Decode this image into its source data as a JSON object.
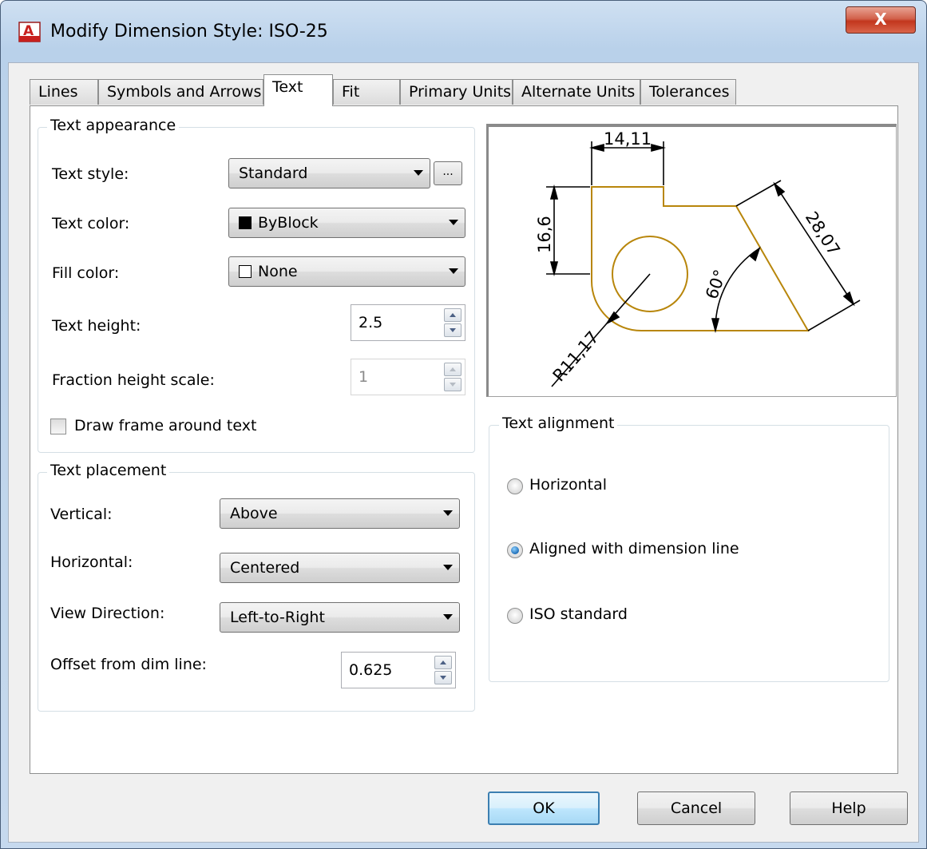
{
  "window": {
    "title": "Modify Dimension Style: ISO-25",
    "close_label": "X"
  },
  "tabs": [
    {
      "label": "Lines"
    },
    {
      "label": "Symbols and Arrows"
    },
    {
      "label": "Text"
    },
    {
      "label": "Fit"
    },
    {
      "label": "Primary Units"
    },
    {
      "label": "Alternate Units"
    },
    {
      "label": "Tolerances"
    }
  ],
  "active_tab": "Text",
  "text_appearance": {
    "title": "Text appearance",
    "text_style": {
      "label": "Text style:",
      "value": "Standard",
      "browse_label": "..."
    },
    "text_color": {
      "label": "Text color:",
      "value": "ByBlock",
      "swatch": "#000000"
    },
    "fill_color": {
      "label": "Fill color:",
      "value": "None",
      "swatch": "#ffffff"
    },
    "text_height": {
      "label": "Text height:",
      "value": "2.5"
    },
    "fraction_height_scale": {
      "label": "Fraction height scale:",
      "value": "1",
      "enabled": false
    },
    "draw_frame": {
      "label": "Draw frame around text",
      "checked": false
    }
  },
  "text_placement": {
    "title": "Text placement",
    "vertical": {
      "label": "Vertical:",
      "value": "Above"
    },
    "horizontal": {
      "label": "Horizontal:",
      "value": "Centered"
    },
    "view_direction": {
      "label": "View Direction:",
      "value": "Left-to-Right"
    },
    "offset": {
      "label": "Offset from dim line:",
      "value": "0.625"
    }
  },
  "preview": {
    "dims": {
      "top": "14,11",
      "left": "16,6",
      "slant": "28,07",
      "angle": "60°",
      "radius": "R11,17"
    },
    "colors": {
      "geometry": "#b8860b",
      "dimension": "#000000"
    }
  },
  "text_alignment": {
    "title": "Text alignment",
    "options": [
      {
        "label": "Horizontal",
        "selected": false
      },
      {
        "label": "Aligned with dimension line",
        "selected": true
      },
      {
        "label": "ISO standard",
        "selected": false
      }
    ]
  },
  "footer": {
    "ok_label": "OK",
    "cancel_label": "Cancel",
    "help_label": "Help"
  }
}
